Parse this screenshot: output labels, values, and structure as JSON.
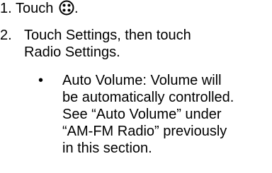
{
  "steps": [
    {
      "number": "1.",
      "text_before_icon": "Touch ",
      "icon": "menu-dots-icon",
      "text_after_icon": "."
    },
    {
      "number": "2.",
      "lines": [
        "Touch Settings, then touch",
        "Radio Settings."
      ]
    }
  ],
  "bullet": {
    "marker": "•",
    "lines": [
      "Auto Volume: Volume will",
      "be automatically controlled.",
      "See “Auto Volume” under",
      "“AM-FM Radio” previously",
      "in this section."
    ]
  }
}
